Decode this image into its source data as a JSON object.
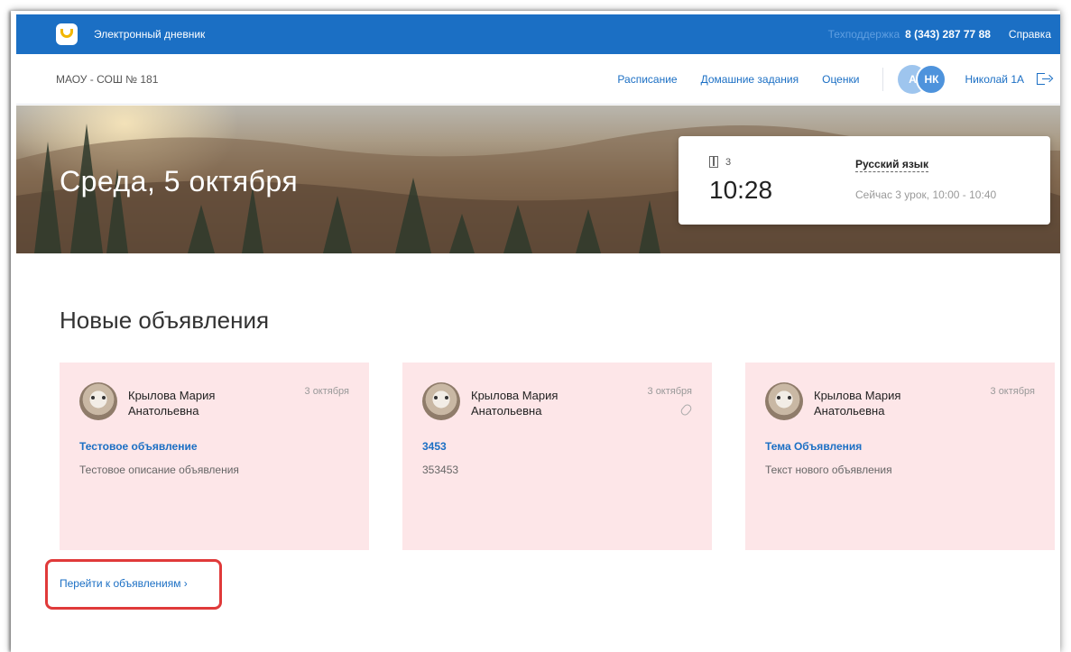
{
  "topbar": {
    "app_title": "Электронный дневник",
    "support_label": "Техподдержка",
    "support_phone": "8 (343) 287 77 88",
    "help_label": "Справка"
  },
  "navbar": {
    "school": "МАОУ - СОШ № 181",
    "links": [
      "Расписание",
      "Домашние задания",
      "Оценки"
    ],
    "avatar_a": "А",
    "avatar_b": "НК",
    "user_name": "Николай 1А"
  },
  "banner": {
    "date": "Среда, 5 октября",
    "lesson": {
      "room": "3",
      "time": "10:28",
      "subject": "Русский язык",
      "info": "Сейчас 3 урок, 10:00 - 10:40"
    }
  },
  "announcements": {
    "title": "Новые объявления",
    "cards": [
      {
        "author_line1": "Крылова Мария",
        "author_line2": "Анатольевна",
        "date": "3 октября",
        "title": "Тестовое объявление",
        "text": "Тестовое описание объявления",
        "attachment": false
      },
      {
        "author_line1": "Крылова Мария",
        "author_line2": "Анатольевна",
        "date": "3 октября",
        "title": "3453",
        "text": "353453",
        "attachment": true
      },
      {
        "author_line1": "Крылова Мария",
        "author_line2": "Анатольевна",
        "date": "3 октября",
        "title": "Тема Объявления",
        "text": "Текст нового объявления",
        "attachment": false
      }
    ],
    "goto_label": "Перейти к объявлениям ›"
  },
  "colors": {
    "brand_blue": "#1b6fc4",
    "card_bg": "#fde6e8",
    "highlight": "#e03a3a"
  }
}
